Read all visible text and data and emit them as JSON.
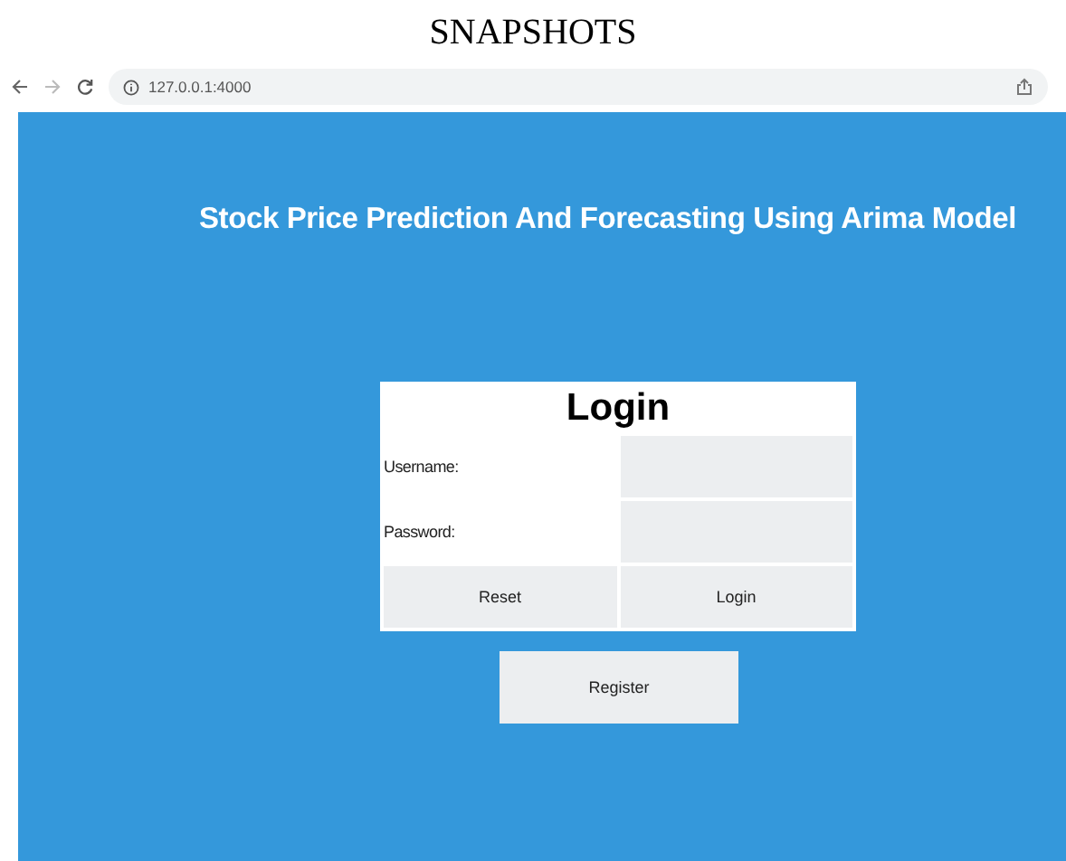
{
  "document": {
    "heading": "SNAPSHOTS"
  },
  "browser": {
    "url": "127.0.0.1:4000"
  },
  "page": {
    "title": "Stock Price Prediction And Forecasting Using Arima Model",
    "login": {
      "heading": "Login",
      "fields": [
        {
          "label": "Username:"
        },
        {
          "label": "Password:"
        }
      ],
      "buttons": [
        "Reset",
        "Login"
      ]
    },
    "register_button": "Register"
  }
}
